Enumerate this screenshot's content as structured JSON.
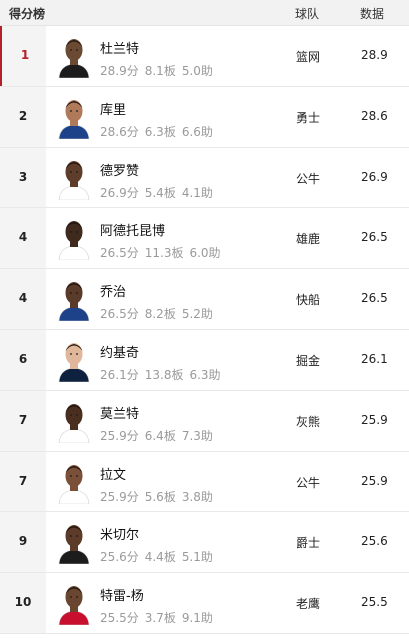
{
  "header": {
    "title": "得分榜",
    "team_col": "球队",
    "stat_col": "数据"
  },
  "players": [
    {
      "rank": "1",
      "name": "杜兰特",
      "pts": "28.9分",
      "reb": "8.1板",
      "ast": "5.0助",
      "team": "篮网",
      "value": "28.9",
      "skin": "#6b4a34",
      "jersey": "#1c1c1c"
    },
    {
      "rank": "2",
      "name": "库里",
      "pts": "28.6分",
      "reb": "6.3板",
      "ast": "6.6助",
      "team": "勇士",
      "value": "28.6",
      "skin": "#b07a5a",
      "jersey": "#1d428a"
    },
    {
      "rank": "3",
      "name": "德罗赞",
      "pts": "26.9分",
      "reb": "5.4板",
      "ast": "4.1助",
      "team": "公牛",
      "value": "26.9",
      "skin": "#5e3d2b",
      "jersey": "#ffffff"
    },
    {
      "rank": "4",
      "name": "阿德托昆博",
      "pts": "26.5分",
      "reb": "11.3板",
      "ast": "6.0助",
      "team": "雄鹿",
      "value": "26.5",
      "skin": "#3f2a1e",
      "jersey": "#ffffff"
    },
    {
      "rank": "4",
      "name": "乔治",
      "pts": "26.5分",
      "reb": "8.2板",
      "ast": "5.2助",
      "team": "快船",
      "value": "26.5",
      "skin": "#5a3a28",
      "jersey": "#1d428a"
    },
    {
      "rank": "6",
      "name": "约基奇",
      "pts": "26.1分",
      "reb": "13.8板",
      "ast": "6.3助",
      "team": "掘金",
      "value": "26.1",
      "skin": "#e0b79a",
      "jersey": "#0e2240"
    },
    {
      "rank": "7",
      "name": "莫兰特",
      "pts": "25.9分",
      "reb": "6.4板",
      "ast": "7.3助",
      "team": "灰熊",
      "value": "25.9",
      "skin": "#4a2e20",
      "jersey": "#ffffff"
    },
    {
      "rank": "7",
      "name": "拉文",
      "pts": "25.9分",
      "reb": "5.6板",
      "ast": "3.8助",
      "team": "公牛",
      "value": "25.9",
      "skin": "#7a5038",
      "jersey": "#ffffff"
    },
    {
      "rank": "9",
      "name": "米切尔",
      "pts": "25.6分",
      "reb": "4.4板",
      "ast": "5.1助",
      "team": "爵士",
      "value": "25.6",
      "skin": "#5c3b28",
      "jersey": "#1c1c1c"
    },
    {
      "rank": "10",
      "name": "特雷-杨",
      "pts": "25.5分",
      "reb": "3.7板",
      "ast": "9.1助",
      "team": "老鹰",
      "value": "25.5",
      "skin": "#6a4530",
      "jersey": "#c8102e"
    }
  ],
  "colors": {
    "accent": "#b4202a",
    "stats_gray": "#9a9a9a",
    "header_bg": "#f2f2f2"
  }
}
